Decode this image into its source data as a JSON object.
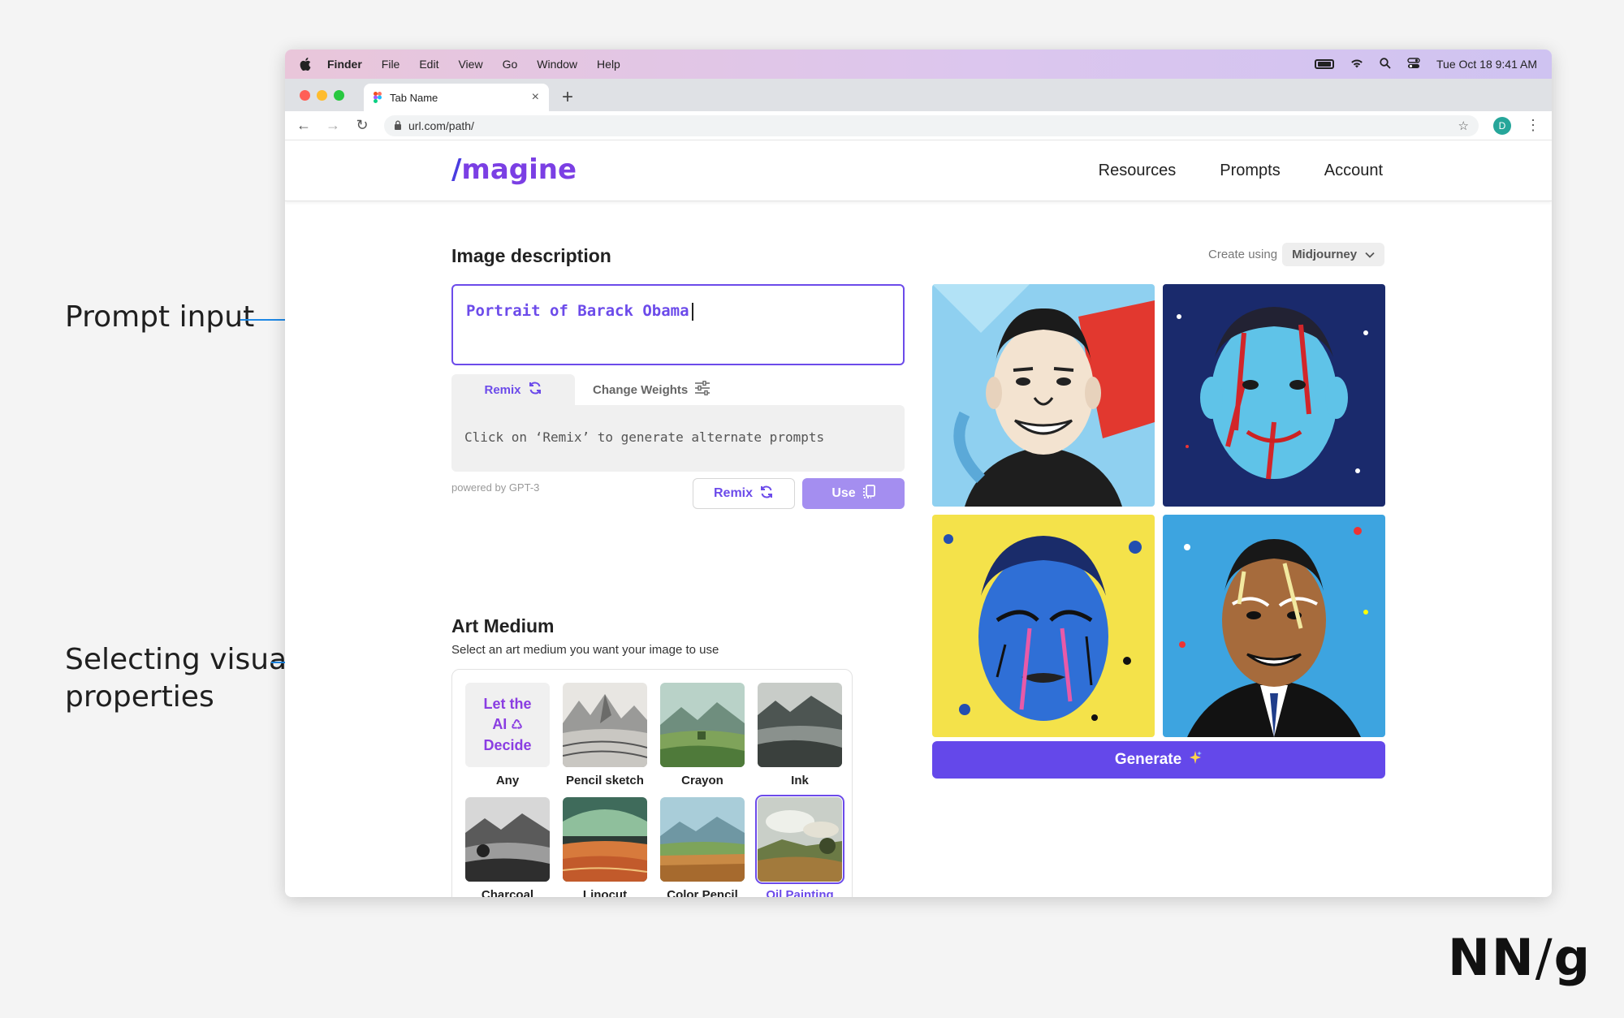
{
  "annotations": {
    "prompt_input": "Prompt input",
    "selecting_visual_line1": "Selecting visual",
    "selecting_visual_line2": "properties"
  },
  "brand": {
    "nng_left": "NN",
    "nng_slash": "/",
    "nng_right": "g"
  },
  "menubar": {
    "items": [
      "Finder",
      "File",
      "Edit",
      "View",
      "Go",
      "Window",
      "Help"
    ],
    "clock": "Tue Oct 18  9:41 AM"
  },
  "browser": {
    "tab_title": "Tab Name",
    "url": "url.com/path/",
    "profile_initial": "D"
  },
  "site": {
    "logo_slash": "/",
    "logo_text": "magine",
    "nav": [
      "Resources",
      "Prompts",
      "Account"
    ]
  },
  "image_description": {
    "heading": "Image description",
    "create_using_label": "Create using",
    "model": "Midjourney",
    "prompt_value": "Portrait of Barack Obama",
    "tabs": [
      "Remix",
      "Change Weights"
    ],
    "remix_hint": "Click on ‘Remix’ to generate alternate prompts",
    "powered_by": "powered by GPT-3",
    "remix_button": "Remix",
    "use_button": "Use"
  },
  "art_medium": {
    "heading": "Art Medium",
    "subtitle": "Select an art medium you want your image to use",
    "let_ai_line1": "Let the",
    "let_ai_line2": "AI",
    "let_ai_line3": "Decide",
    "items": [
      "Any",
      "Pencil sketch",
      "Crayon",
      "Ink",
      "Charcoal",
      "Linocut",
      "Color Pencil",
      "Oil Painting"
    ],
    "selected": "Oil Painting"
  },
  "generate": {
    "label": "Generate"
  },
  "colors": {
    "accent": "#6c4bea",
    "generate": "#6448ea",
    "annotation_line": "#1e88e5"
  }
}
